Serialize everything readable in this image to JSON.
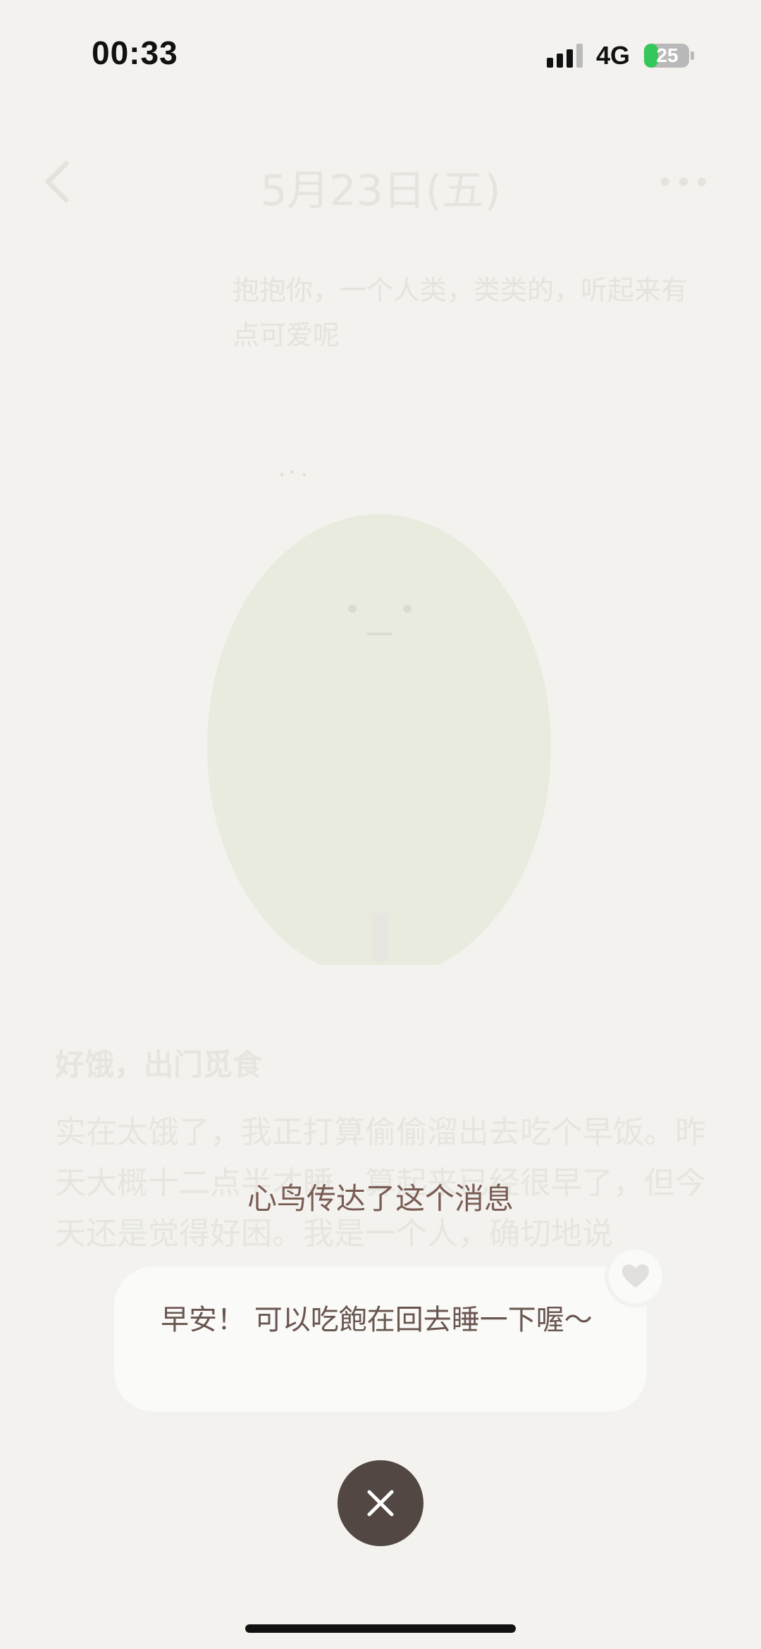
{
  "status_bar": {
    "time": "00:33",
    "network": "4G",
    "battery_level": "25"
  },
  "background_page": {
    "title": "5月23日(五)",
    "reply": "抱抱你，一个人类，类类的，听起来有点可爱呢",
    "entry_title": "好饿，出门觅食",
    "entry_body": "实在太饿了，我正打算偷偷溜出去吃个早饭。昨天大概十二点半才睡，算起来已经很早了，但今天还是觉得好困。我是一个人，确切地说"
  },
  "popup": {
    "caption": "心鸟传达了这个消息",
    "message": "早安！ 可以吃飽在回去睡一下喔～"
  },
  "icons": {
    "back": "chevron-left-icon",
    "more": "more-dots-icon",
    "heart": "heart-icon",
    "close": "close-icon"
  },
  "colors": {
    "background": "#f3f2ee",
    "caption": "#7a5c54",
    "close_button": "#524742",
    "battery_fill": "#34c759"
  }
}
